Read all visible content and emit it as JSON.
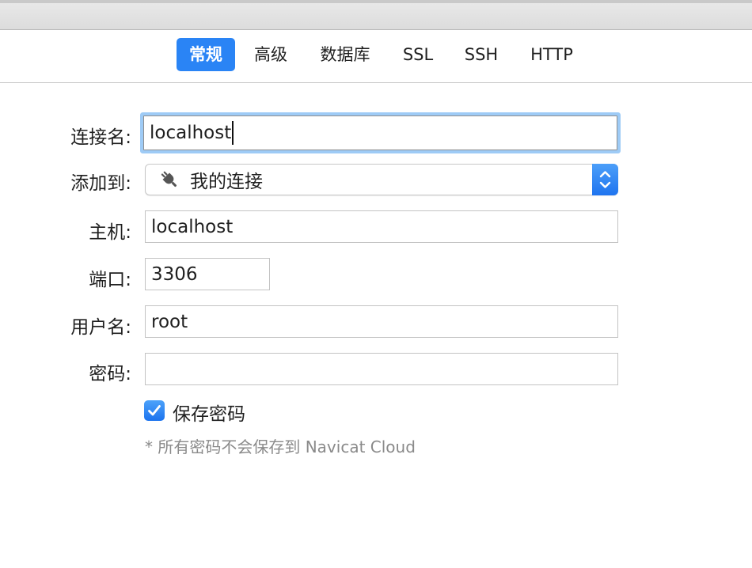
{
  "tabs": [
    {
      "label": "常规",
      "active": true
    },
    {
      "label": "高级",
      "active": false
    },
    {
      "label": "数据库",
      "active": false
    },
    {
      "label": "SSL",
      "active": false
    },
    {
      "label": "SSH",
      "active": false
    },
    {
      "label": "HTTP",
      "active": false
    }
  ],
  "form": {
    "connection_name": {
      "label": "连接名:",
      "value": "localhost"
    },
    "add_to": {
      "label": "添加到:",
      "value": "我的连接",
      "icon": "plug-icon"
    },
    "host": {
      "label": "主机:",
      "value": "localhost"
    },
    "port": {
      "label": "端口:",
      "value": "3306"
    },
    "username": {
      "label": "用户名:",
      "value": "root"
    },
    "password": {
      "label": "密码:",
      "value": ""
    },
    "save_password": {
      "label": "保存密码",
      "checked": true
    },
    "note": "* 所有密码不会保存到 Navicat Cloud"
  },
  "colors": {
    "accent": "#2a84f5",
    "focus_ring": "#9ecbf6",
    "note_text": "#8a8a8a"
  }
}
